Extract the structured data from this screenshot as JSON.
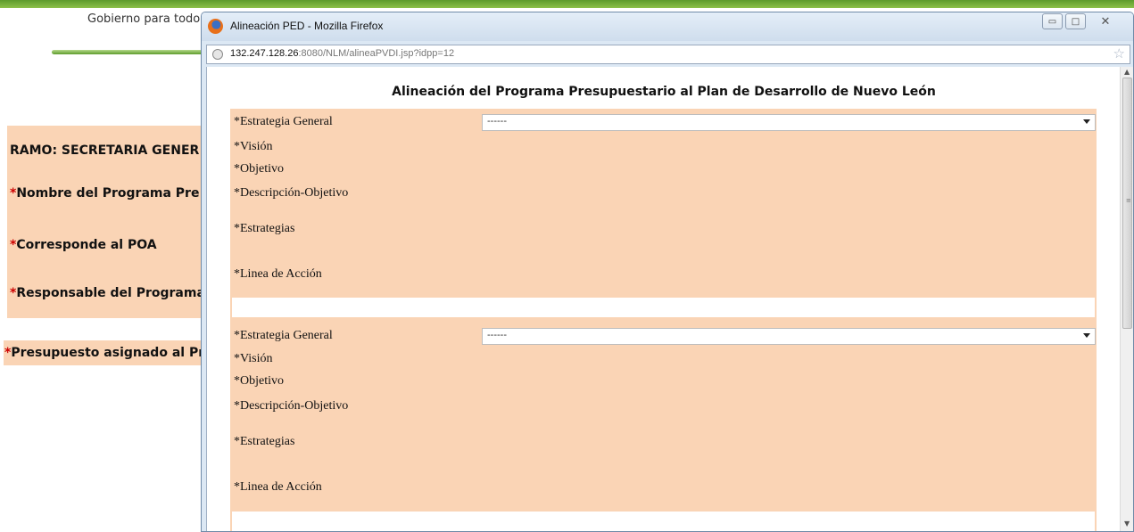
{
  "background_page": {
    "gobierno_text": "Gobierno para todo",
    "panel": {
      "ramo": "RAMO: SECRETARIA GENER",
      "asterisk": "*",
      "nombre": "Nombre del Programa Pre",
      "poa": "Corresponde al POA",
      "responsable": "Responsable del Programa"
    },
    "presupuesto": "Presupuesto asignado al Pr"
  },
  "window": {
    "title": "Alineación PED - Mozilla Firefox",
    "buttons": {
      "minimize": "▭",
      "maximize": "□",
      "close": "✕"
    },
    "url_host": "132.247.128.26",
    "url_rest": ":8080/NLM/alineaPVDI.jsp?idpp=12",
    "bookmark_star": "☆"
  },
  "form": {
    "title": "Alineación del Programa Presupuestario al Plan de Desarrollo de Nuevo León",
    "blocks": [
      {
        "estrategia_general": "*Estrategia General",
        "select_value": "------",
        "vision": "*Visión",
        "objetivo": "*Objetivo",
        "descripcion_objetivo": "*Descripción-Objetivo",
        "estrategias": "*Estrategias",
        "linea_accion": "*Linea de Acción"
      },
      {
        "estrategia_general": "*Estrategia General",
        "select_value": "------",
        "vision": "*Visión",
        "objetivo": "*Objetivo",
        "descripcion_objetivo": "*Descripción-Objetivo",
        "estrategias": "*Estrategias",
        "linea_accion": "*Linea de Acción"
      }
    ]
  },
  "scrollbar": {
    "up": "▲",
    "down": "▼",
    "grip": "≡"
  }
}
